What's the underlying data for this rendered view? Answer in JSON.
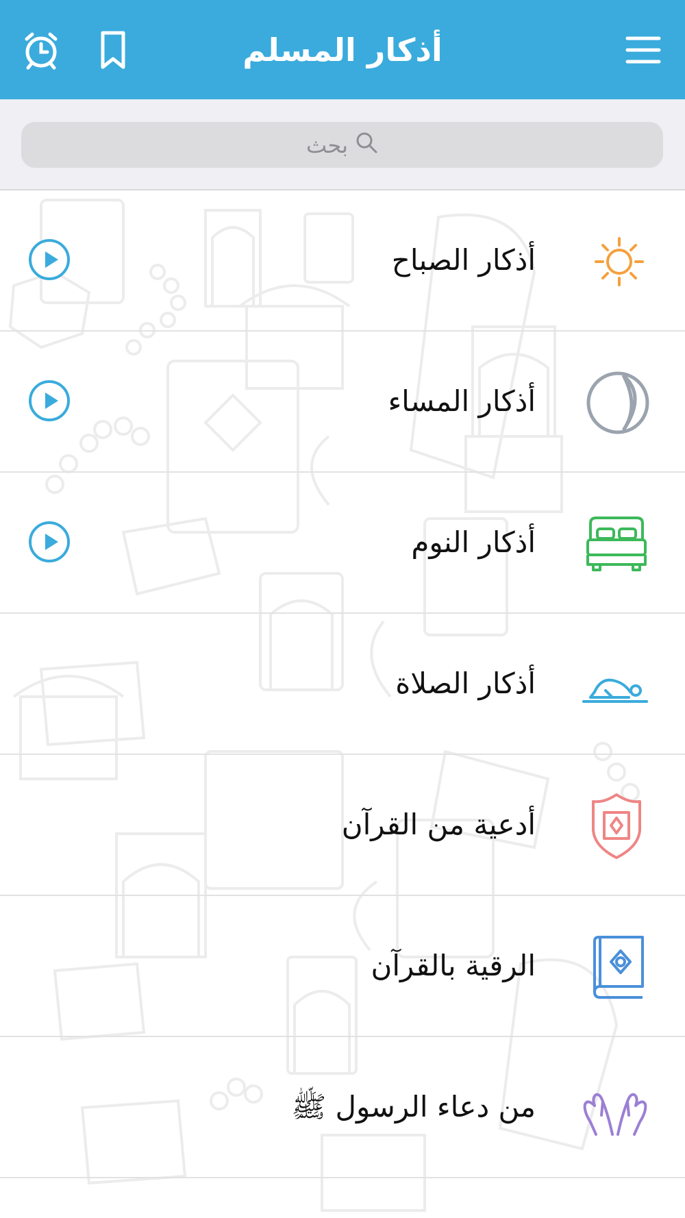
{
  "header": {
    "title": "أذكار المسلم",
    "icons": {
      "alarm": "alarm-icon",
      "bookmark": "bookmark-icon",
      "menu": "hamburger-menu-icon"
    },
    "color": "#3aabdc"
  },
  "search": {
    "placeholder": "بحث",
    "icon": "search-icon"
  },
  "items": [
    {
      "label": "أذكار الصباح",
      "icon": "sun-icon",
      "color": "#f5a03c",
      "has_play": true
    },
    {
      "label": "أذكار المساء",
      "icon": "moon-icon",
      "color": "#9aa3ae",
      "has_play": true
    },
    {
      "label": "أذكار النوم",
      "icon": "bed-icon",
      "color": "#3cb95a",
      "has_play": true
    },
    {
      "label": "أذكار الصلاة",
      "icon": "prostrating-person-icon",
      "color": "#3aabdc",
      "has_play": false
    },
    {
      "label": "أدعية من القرآن",
      "icon": "shield-icon",
      "color": "#ef8585",
      "has_play": false
    },
    {
      "label": "الرقية بالقرآن",
      "icon": "quran-book-icon",
      "color": "#4a90d9",
      "has_play": false
    },
    {
      "label": "من دعاء الرسول ﷺ",
      "icon": "praying-hands-icon",
      "color": "#9b7fd4",
      "has_play": false
    }
  ],
  "play_icon": "play-circle-icon",
  "play_color": "#3aabdc"
}
